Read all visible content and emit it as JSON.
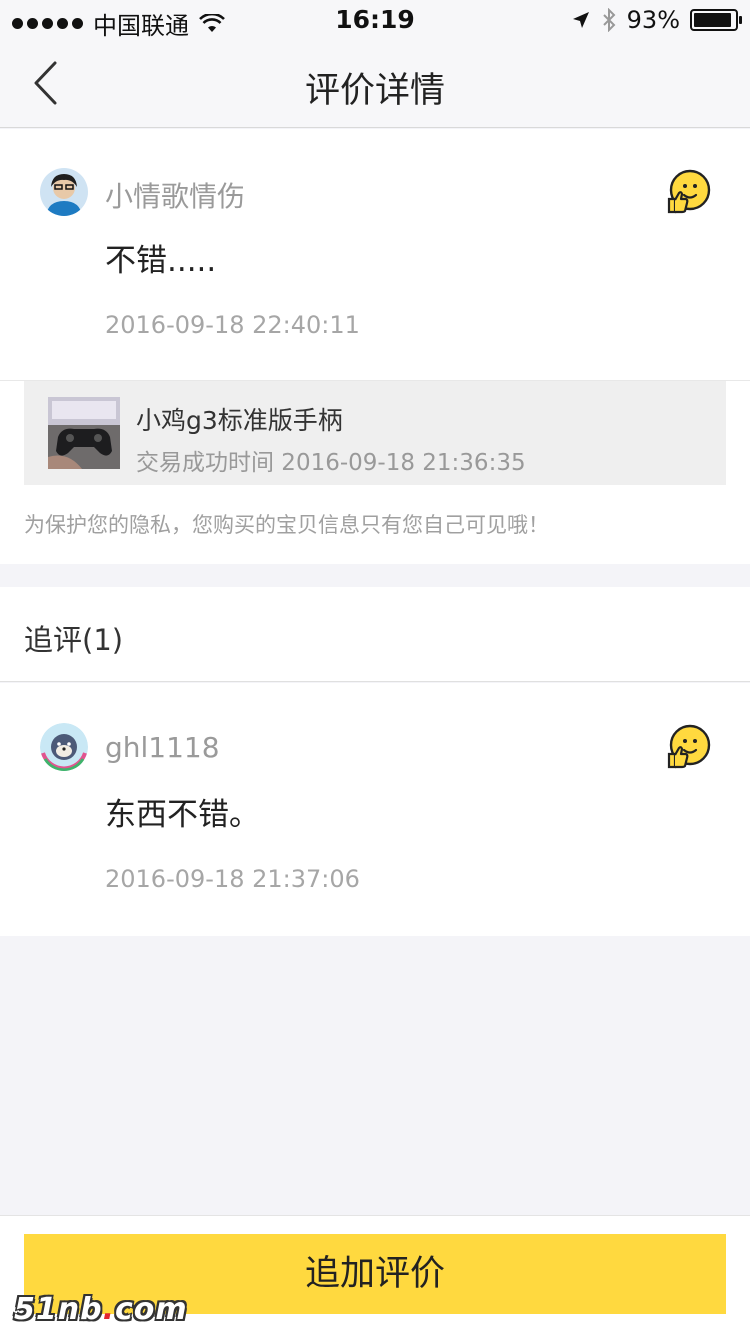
{
  "status_bar": {
    "carrier": "中国联通",
    "time": "16:19",
    "battery": "93%",
    "battery_level": 0.93
  },
  "nav": {
    "title": "评价详情"
  },
  "review": {
    "username": "小情歌情伤",
    "text": "不错.....",
    "time": "2016-09-18 22:40:11"
  },
  "product": {
    "name": "小鸡g3标准版手柄",
    "trade_time": "交易成功时间 2016-09-18 21:36:35",
    "privacy_note": "为保护您的隐私，您购买的宝贝信息只有您自己可见哦！"
  },
  "followup": {
    "title": "追评(1)",
    "username": "ghl1118",
    "text": "东西不错。",
    "time": "2016-09-18 21:37:06"
  },
  "bottom": {
    "button_label": "追加评价"
  },
  "watermark": {
    "main": "51nb",
    "dot": ".",
    "tld": "com"
  },
  "colors": {
    "accent": "#ffd93f",
    "background": "#f4f4f8"
  }
}
